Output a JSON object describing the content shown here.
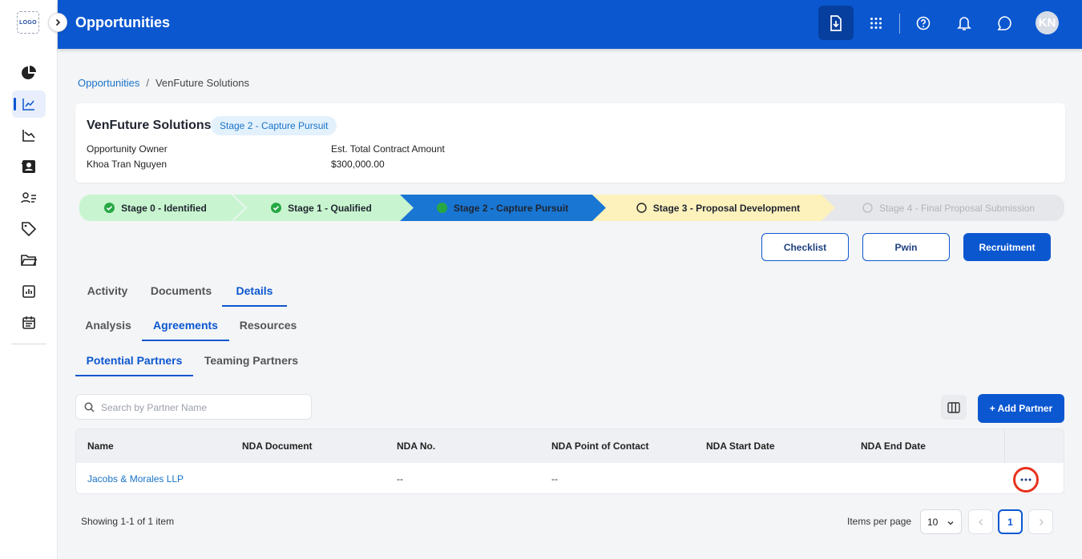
{
  "app": {
    "logo_text": "LOGO",
    "page_title": "Opportunities",
    "user_initials": "KN"
  },
  "sidebar": {
    "items": [
      {
        "name": "dashboard",
        "icon": "pie-chart-icon"
      },
      {
        "name": "opportunities",
        "icon": "trending-chart-icon",
        "active": true
      },
      {
        "name": "pipeline",
        "icon": "line-chart-icon"
      },
      {
        "name": "contacts",
        "icon": "contact-card-icon"
      },
      {
        "name": "users",
        "icon": "user-list-icon"
      },
      {
        "name": "deals",
        "icon": "tag-icon"
      },
      {
        "name": "folders",
        "icon": "folder-icon"
      },
      {
        "name": "reports",
        "icon": "bar-chart-icon"
      },
      {
        "name": "calendar",
        "icon": "calendar-icon"
      }
    ]
  },
  "breadcrumb": {
    "root": "Opportunities",
    "separator": "/",
    "current": "VenFuture Solutions"
  },
  "opportunity": {
    "name": "VenFuture Solutions",
    "stage_chip": "Stage 2 - Capture Pursuit",
    "owner_label": "Opportunity Owner",
    "owner_value": "Khoa Tran Nguyen",
    "amount_label": "Est. Total Contract Amount",
    "amount_value": "$300,000.00"
  },
  "stages": [
    {
      "label": "Stage 0 - Identified",
      "status": "done"
    },
    {
      "label": "Stage 1 - Qualified",
      "status": "done"
    },
    {
      "label": "Stage 2 - Capture Pursuit",
      "status": "current"
    },
    {
      "label": "Stage 3 - Proposal Development",
      "status": "next"
    },
    {
      "label": "Stage 4 - Final Proposal Submission",
      "status": "future"
    }
  ],
  "actions": {
    "checklist": "Checklist",
    "pwin": "Pwin",
    "recruitment": "Recruitment"
  },
  "tabs": {
    "primary": [
      "Activity",
      "Documents",
      "Details"
    ],
    "primary_active": "Details",
    "secondary": [
      "Analysis",
      "Agreements",
      "Resources"
    ],
    "secondary_active": "Agreements",
    "tertiary": [
      "Potential Partners",
      "Teaming Partners"
    ],
    "tertiary_active": "Potential Partners"
  },
  "search": {
    "placeholder": "Search by Partner Name",
    "value": ""
  },
  "add_partner_label": "+ Add Partner",
  "table": {
    "columns": [
      "Name",
      "NDA Document",
      "NDA No.",
      "NDA Point of Contact",
      "NDA Start Date",
      "NDA End Date"
    ],
    "rows": [
      {
        "name": "Jacobs & Morales LLP",
        "nda_document": "",
        "nda_no": "--",
        "nda_poc": "--",
        "nda_start": "",
        "nda_end": ""
      }
    ]
  },
  "pagination": {
    "showing": "Showing 1-1 of 1 item",
    "items_per_page_label": "Items per page",
    "items_per_page": "10",
    "current_page": "1"
  },
  "colors": {
    "primary": "#0b57d0",
    "stage_done": "#c8f5cf",
    "stage_current": "#1976d2",
    "stage_next": "#fdf1bc",
    "stage_future": "#e5e7ea",
    "highlight_ring": "#e8321e"
  }
}
